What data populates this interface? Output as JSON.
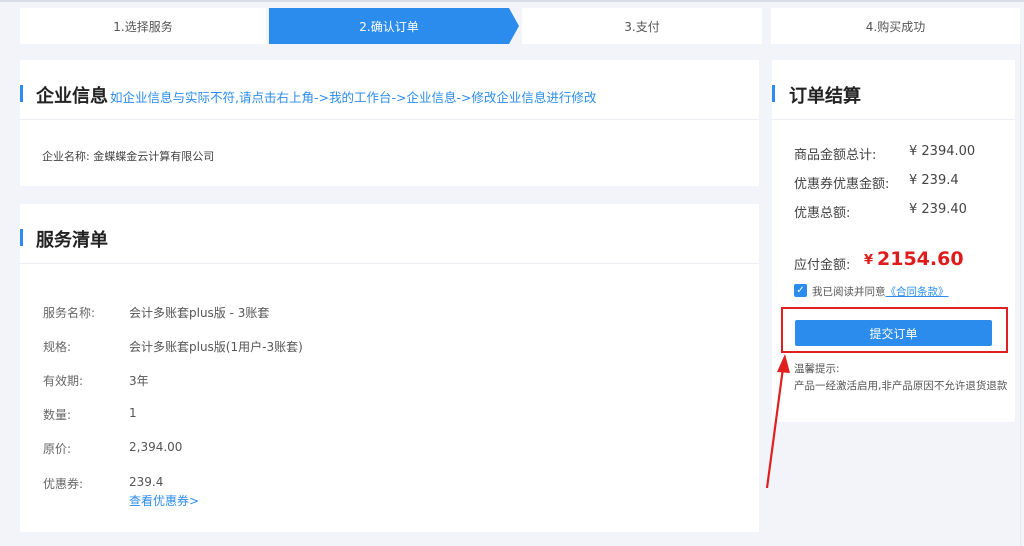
{
  "steps": [
    {
      "label": "1.选择服务"
    },
    {
      "label": "2.确认订单"
    },
    {
      "label": "3.支付"
    },
    {
      "label": "4.购买成功"
    }
  ],
  "company": {
    "title": "企业信息",
    "hint": "如企业信息与实际不符,请点击右上角->我的工作台->企业信息->修改企业信息进行修改",
    "name_label": "企业名称:",
    "name_value": "金蝶蝶金云计算有限公司"
  },
  "services": {
    "title": "服务清单",
    "rows": [
      {
        "label": "服务名称:",
        "value": "会计多账套plus版 - 3账套"
      },
      {
        "label": "规格:",
        "value": "会计多账套plus版(1用户-3账套)"
      },
      {
        "label": "有效期:",
        "value": "3年"
      },
      {
        "label": "数量:",
        "value": "1"
      },
      {
        "label": "原价:",
        "value": "2,394.00"
      },
      {
        "label": "优惠券:",
        "value": "239.4"
      }
    ],
    "coupon_link": "查看优惠券>"
  },
  "summary": {
    "title": "订单结算",
    "rows": [
      {
        "label": "商品金额总计:",
        "value": "¥ 2394.00"
      },
      {
        "label": "优惠券优惠金额:",
        "value": "¥ 239.4"
      },
      {
        "label": "优惠总额:",
        "value": "¥ 239.40"
      }
    ],
    "pay_label": "应付金额:",
    "pay_currency": "¥",
    "pay_amount": "2154.60",
    "agree_text": "我已阅读并同意",
    "agree_link": "《合同条款》",
    "agree_checked": true,
    "submit_label": "提交订单",
    "tips_title": "温馨提示:",
    "tips_text": "产品一经激活启用,非产品原因不允许退货退款"
  },
  "colors": {
    "accent": "#2b8ced",
    "price": "#e01b1b",
    "annotation": "#e02020"
  }
}
